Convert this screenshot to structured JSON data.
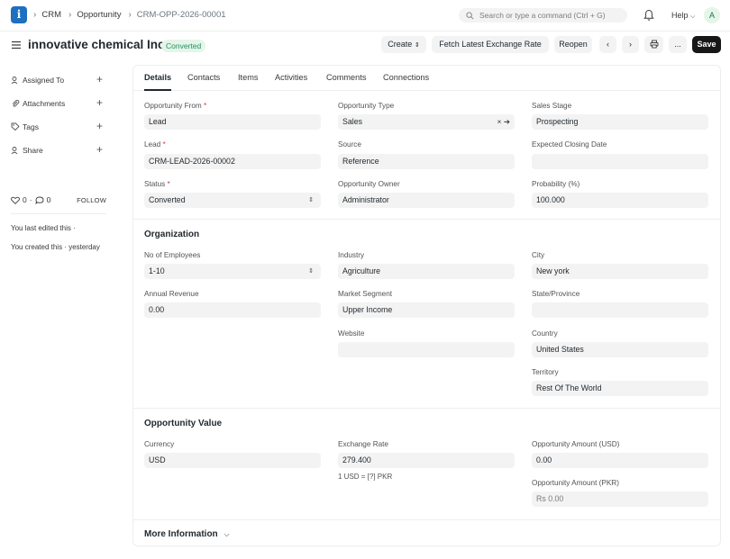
{
  "navbar": {
    "breadcrumbs": [
      "CRM",
      "Opportunity",
      "CRM-OPP-2026-00001"
    ],
    "search_placeholder": "Search or type a command (Ctrl + G)",
    "help_label": "Help",
    "avatar_initial": "A"
  },
  "header": {
    "title": "innovative chemical Inc",
    "status": "Converted",
    "buttons": {
      "create": "Create",
      "fetch_rate": "Fetch Latest Exchange Rate",
      "reopen": "Reopen",
      "more": "...",
      "save": "Save"
    }
  },
  "sidebar": {
    "items": [
      "Assigned To",
      "Attachments",
      "Tags",
      "Share"
    ],
    "likes": "0",
    "comments": "0",
    "follow": "FOLLOW",
    "edited_note": "You last edited this ·",
    "created_note": "You created this · yesterday"
  },
  "tabs": [
    "Details",
    "Contacts",
    "Items",
    "Activities",
    "Comments",
    "Connections"
  ],
  "details": {
    "opportunity_from": {
      "label": "Opportunity From",
      "value": "Lead"
    },
    "opportunity_type": {
      "label": "Opportunity Type",
      "value": "Sales"
    },
    "sales_stage": {
      "label": "Sales Stage",
      "value": "Prospecting"
    },
    "lead": {
      "label": "Lead",
      "value": "CRM-LEAD-2026-00002"
    },
    "source": {
      "label": "Source",
      "value": "Reference"
    },
    "expected_closing": {
      "label": "Expected Closing Date",
      "value": ""
    },
    "status": {
      "label": "Status",
      "value": "Converted"
    },
    "owner": {
      "label": "Opportunity Owner",
      "value": "Administrator"
    },
    "probability": {
      "label": "Probability (%)",
      "value": "100.000"
    }
  },
  "organization": {
    "title": "Organization",
    "employees": {
      "label": "No of Employees",
      "value": "1-10"
    },
    "industry": {
      "label": "Industry",
      "value": "Agriculture"
    },
    "city": {
      "label": "City",
      "value": "New york"
    },
    "revenue": {
      "label": "Annual Revenue",
      "value": "0.00"
    },
    "segment": {
      "label": "Market Segment",
      "value": "Upper Income"
    },
    "state": {
      "label": "State/Province",
      "value": ""
    },
    "website": {
      "label": "Website",
      "value": ""
    },
    "country": {
      "label": "Country",
      "value": "United States"
    },
    "territory": {
      "label": "Territory",
      "value": "Rest Of The World"
    }
  },
  "value_section": {
    "title": "Opportunity Value",
    "currency": {
      "label": "Currency",
      "value": "USD"
    },
    "exchange_rate": {
      "label": "Exchange Rate",
      "value": "279.400",
      "hint": "1 USD = [?] PKR"
    },
    "amount_usd": {
      "label": "Opportunity Amount (USD)",
      "value": "0.00"
    },
    "amount_pkr": {
      "label": "Opportunity Amount (PKR)",
      "value": "Rs 0.00"
    }
  },
  "more_info": "More Information"
}
